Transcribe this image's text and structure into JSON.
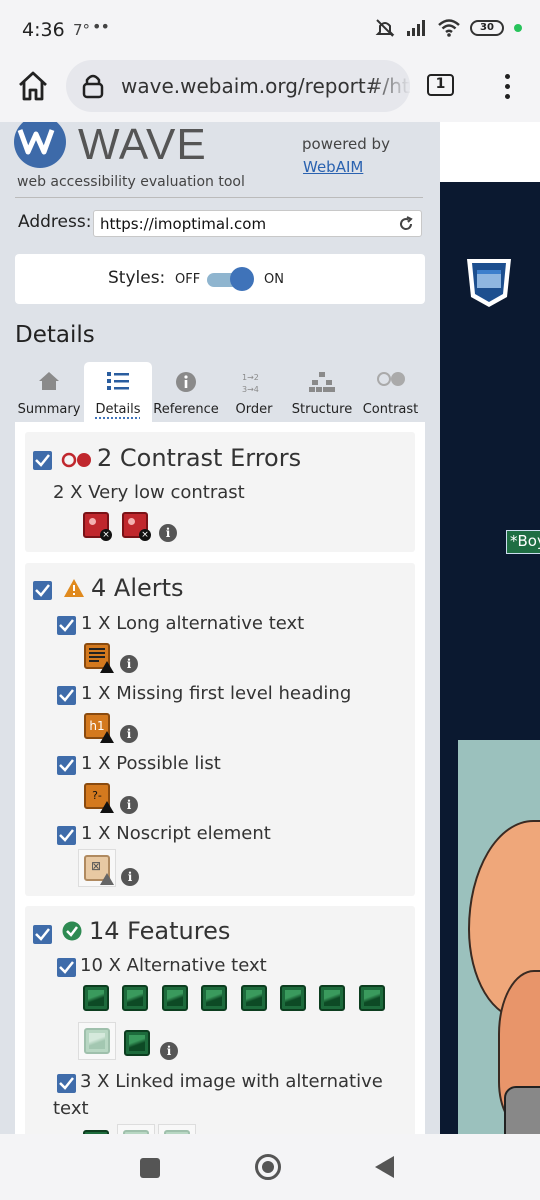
{
  "status": {
    "time": "4:36",
    "temp": "7°",
    "dots": "••",
    "battery": "30"
  },
  "browser": {
    "url": "wave.webaim.org/report#/https://imoptimal.com",
    "tab_count": "1"
  },
  "wave": {
    "logo_text": "WAVE",
    "subtitle": "web accessibility evaluation tool",
    "powered_by": "powered by",
    "webaim_link": "WebAIM",
    "address_label": "Address:",
    "address_value": "https://imoptimal.com",
    "styles_label": "Styles:",
    "styles_off": "OFF",
    "styles_on": "ON",
    "details_heading": "Details"
  },
  "tabs": [
    {
      "label": "Summary",
      "icon": "home-icon"
    },
    {
      "label": "Details",
      "icon": "list-icon",
      "active": true
    },
    {
      "label": "Reference",
      "icon": "info-icon"
    },
    {
      "label": "Order",
      "icon": "order-icon"
    },
    {
      "label": "Structure",
      "icon": "structure-icon"
    },
    {
      "label": "Contrast",
      "icon": "contrast-icon"
    }
  ],
  "errors": {
    "title": "2 Contrast Errors",
    "items": [
      {
        "label": "2 X Very low contrast",
        "icon_count": 2
      }
    ]
  },
  "alerts": {
    "title": "4 Alerts",
    "items": [
      {
        "label": "1 X Long alternative text"
      },
      {
        "label": "1 X Missing first level heading",
        "icon_text": "h1"
      },
      {
        "label": "1 X Possible list",
        "icon_text": "?-"
      },
      {
        "label": "1 X Noscript element"
      }
    ]
  },
  "features": {
    "title": "14 Features",
    "items": [
      {
        "label": "10 X Alternative text",
        "icon_count": 10
      },
      {
        "label_line1": "3 X Linked image with alternative",
        "label_line2": "text",
        "icon_count": 3
      }
    ]
  },
  "preview": {
    "tag_text": "*Boy"
  },
  "colors": {
    "checkbox": "#3f6caa",
    "error": "#c0272d",
    "alert": "#d4791e",
    "feature": "#1d6b3c",
    "link": "#2a62b0"
  }
}
